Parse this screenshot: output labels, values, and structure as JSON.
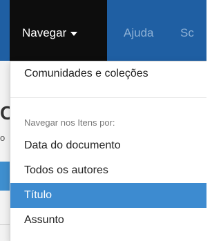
{
  "navbar": {
    "items": [
      {
        "label": "Navegar",
        "active": true
      },
      {
        "label": "Ajuda"
      },
      {
        "label": "Sc"
      }
    ]
  },
  "background": {
    "heading": "C",
    "small": "o"
  },
  "dropdown": {
    "top_item": "Comunidades e coleções",
    "section_header": "Navegar nos Itens por:",
    "items": [
      {
        "label": "Data do documento"
      },
      {
        "label": "Todos os autores"
      },
      {
        "label": "Título",
        "active": true
      },
      {
        "label": "Assunto"
      }
    ]
  },
  "colors": {
    "navbar": "#1f5fa3",
    "active_nav": "#0d0d0d",
    "active_item": "#3d8bd0"
  }
}
